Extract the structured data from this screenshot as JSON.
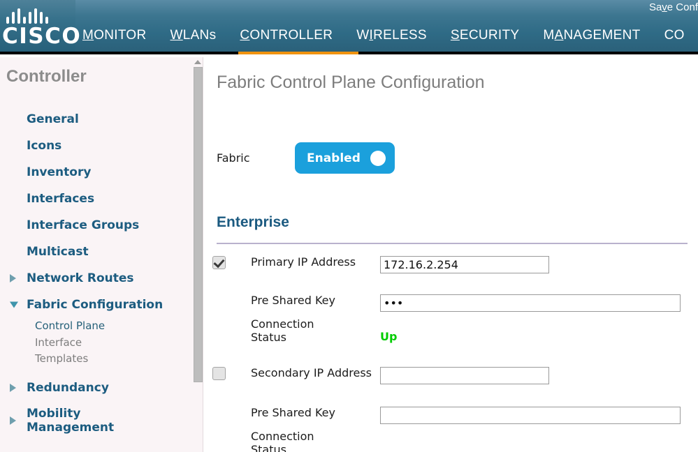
{
  "topbar": {
    "brand": "CISCO",
    "brand_icon": "cisco-bridge-logo",
    "save_config": "Save Conf",
    "nav": [
      {
        "label": "MONITOR",
        "accesskey": "M",
        "active": false
      },
      {
        "label": "WLANs",
        "accesskey": "W",
        "active": false
      },
      {
        "label": "CONTROLLER",
        "accesskey": "C",
        "active": true
      },
      {
        "label": "WIRELESS",
        "accesskey": "I",
        "active": false
      },
      {
        "label": "SECURITY",
        "accesskey": "S",
        "active": false
      },
      {
        "label": "MANAGEMENT",
        "accesskey": "A",
        "active": false
      },
      {
        "label": "CO",
        "accesskey": "",
        "active": false
      }
    ],
    "active_accent_color": "#f0930f"
  },
  "sidebar": {
    "title": "Controller",
    "items": [
      {
        "label": "General",
        "expandable": false
      },
      {
        "label": "Icons",
        "expandable": false
      },
      {
        "label": "Inventory",
        "expandable": false
      },
      {
        "label": "Interfaces",
        "expandable": false
      },
      {
        "label": "Interface Groups",
        "expandable": false
      },
      {
        "label": "Multicast",
        "expandable": false
      },
      {
        "label": "Network Routes",
        "expandable": true,
        "expanded": false
      },
      {
        "label": "Fabric Configuration",
        "expandable": true,
        "expanded": true
      },
      {
        "label": "Redundancy",
        "expandable": true,
        "expanded": false
      },
      {
        "label": "Mobility Management",
        "expandable": true,
        "expanded": false
      }
    ],
    "fabric_subitems": [
      {
        "label": "Control Plane",
        "current": true
      },
      {
        "label": "Interface",
        "current": false
      },
      {
        "label": "Templates",
        "current": false
      }
    ],
    "scrollbar": {
      "up_arrow_icon": "triangle-up-icon"
    }
  },
  "main": {
    "page_title": "Fabric Control Plane Configuration",
    "fabric": {
      "label": "Fabric",
      "toggle_state": "Enabled",
      "toggle_color": "#1ba0dc"
    },
    "enterprise": {
      "heading": "Enterprise",
      "primary": {
        "checkbox_checked": true,
        "ip_label": "Primary IP Address",
        "ip_value": "172.16.2.254",
        "psk_label": "Pre Shared Key",
        "psk_value": "•••",
        "status_label": "Connection Status",
        "status_value": "Up",
        "status_color": "#00cc00"
      },
      "secondary": {
        "checkbox_checked": false,
        "ip_label": "Secondary IP Address",
        "ip_value": "",
        "psk_label": "Pre Shared Key",
        "psk_value": "",
        "status_label": "Connection Status"
      }
    }
  }
}
